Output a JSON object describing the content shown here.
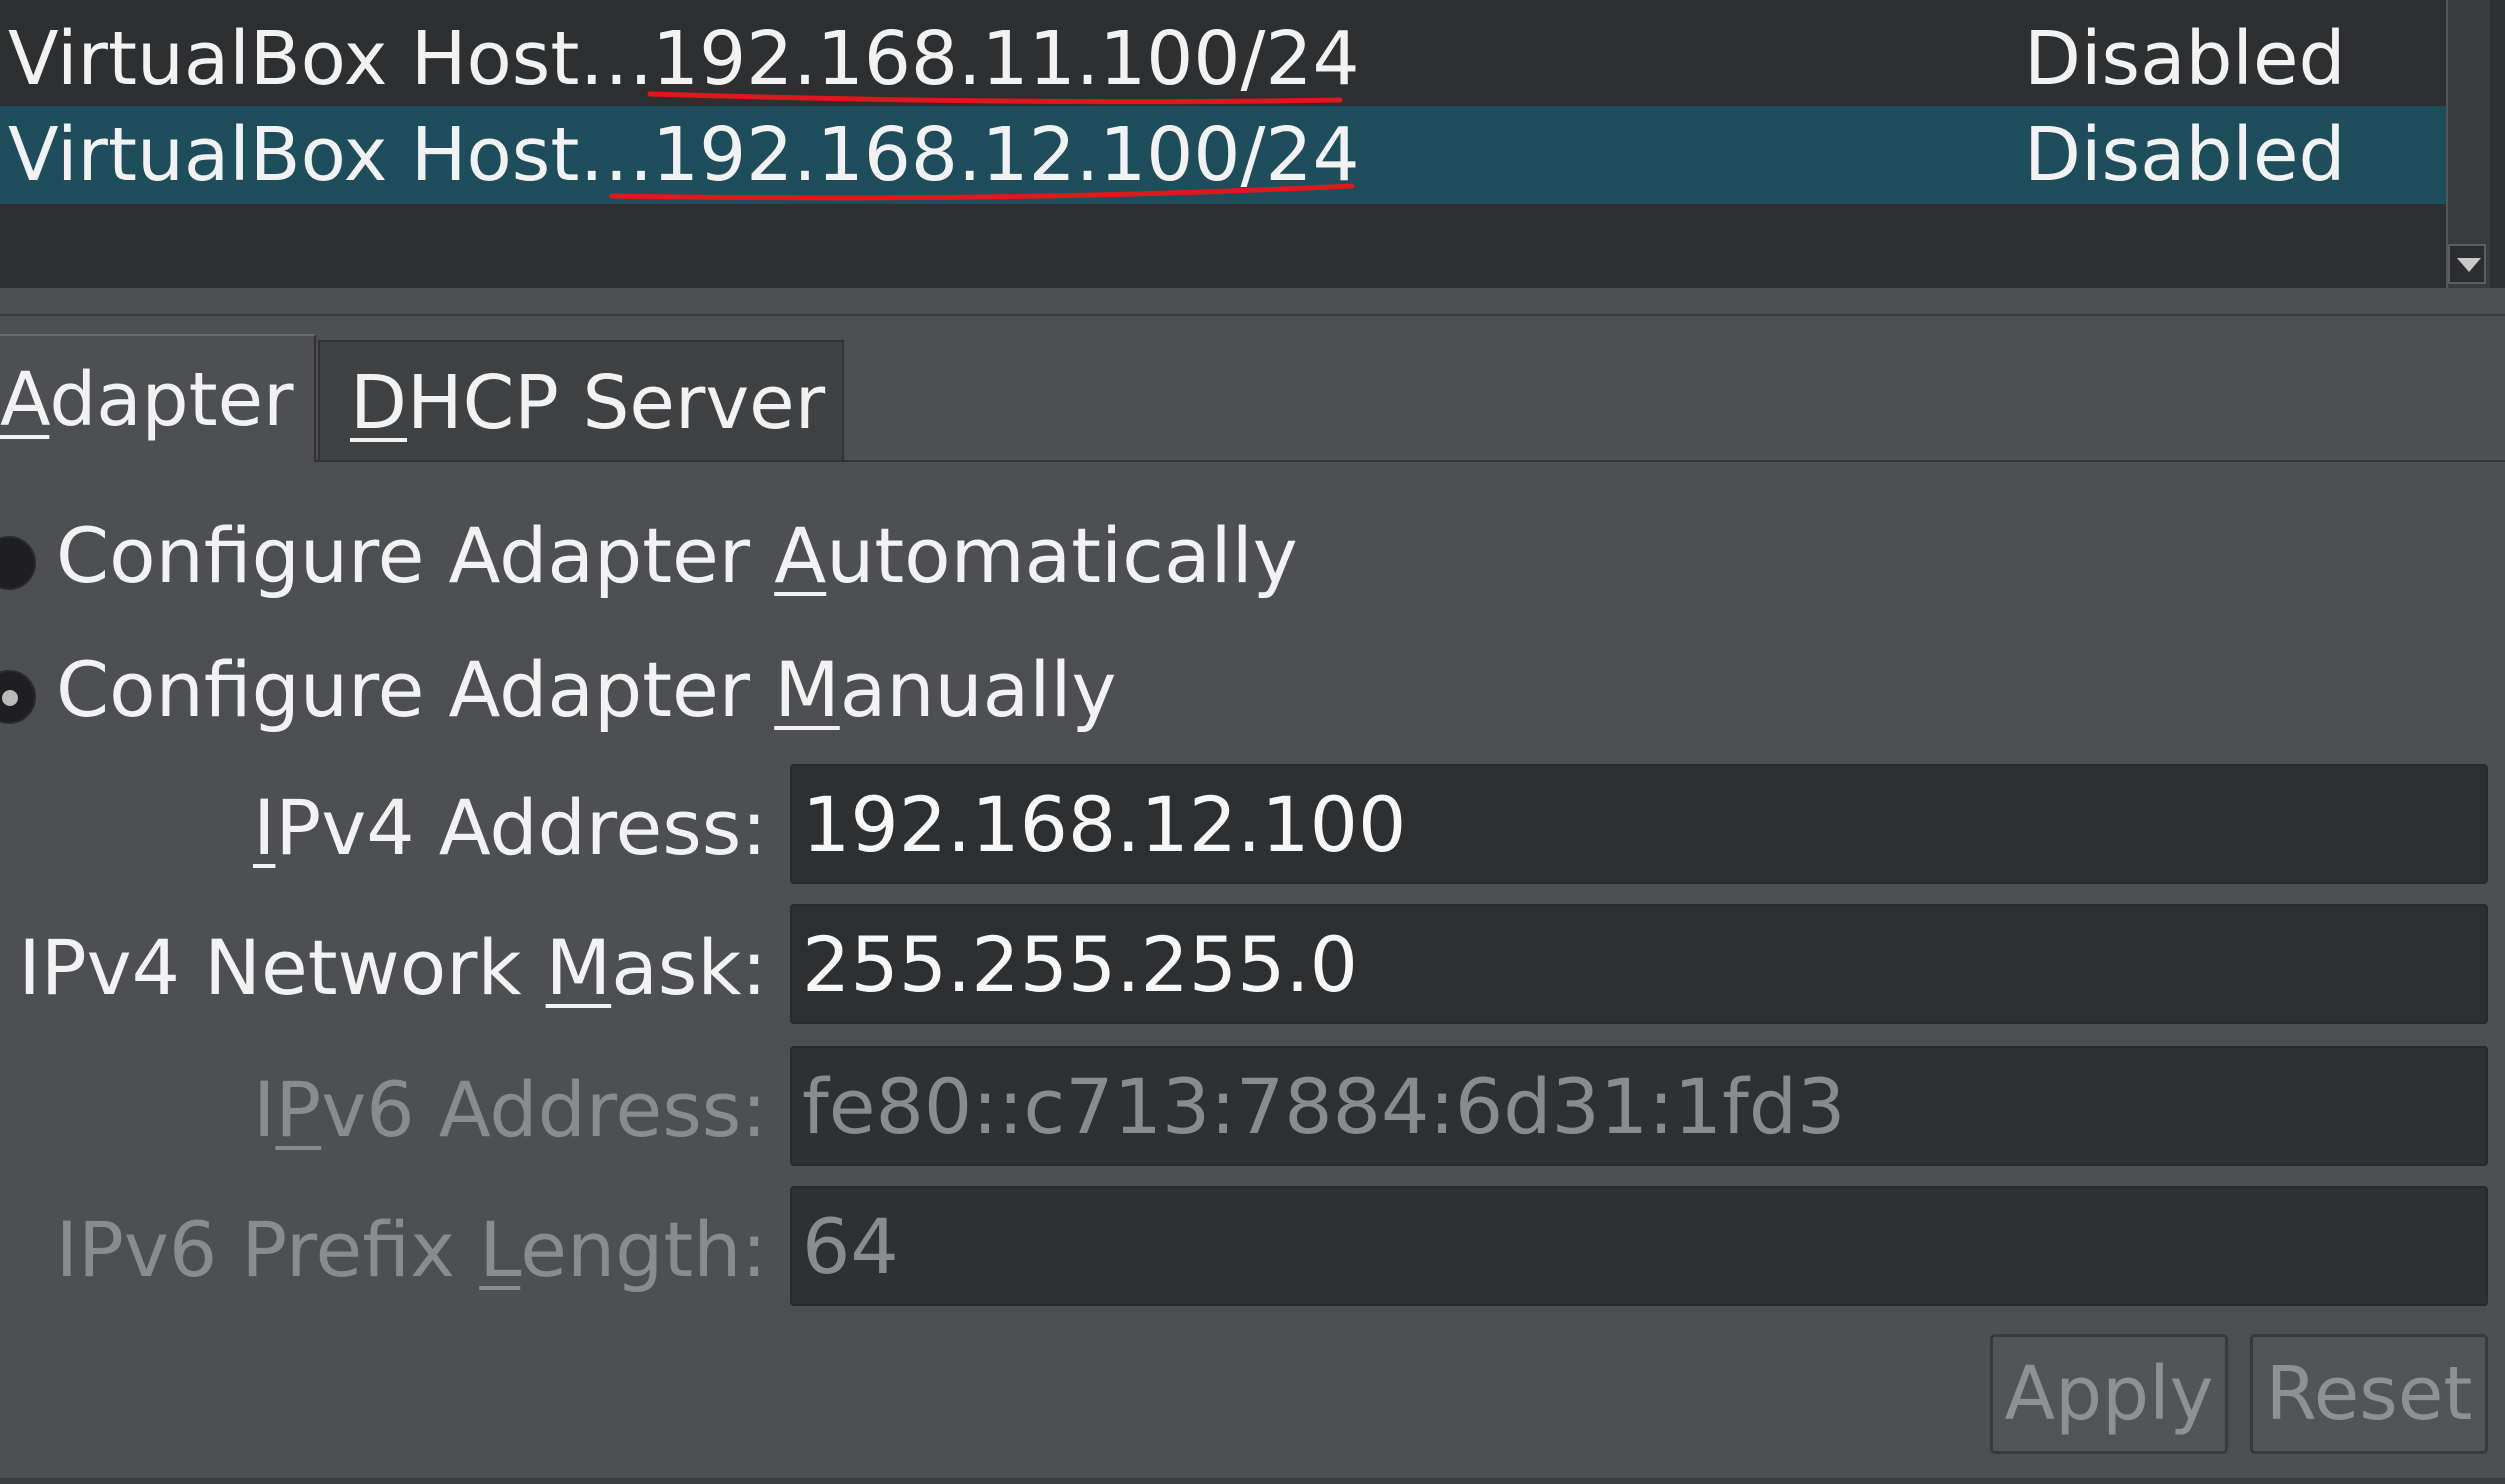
{
  "host_networks": {
    "rows": [
      {
        "name": "VirtualBox Host…",
        "ipv4": "192.168.11.100/24",
        "dhcp": "Disabled",
        "selected": false
      },
      {
        "name": "VirtualBox Host…",
        "ipv4": "192.168.12.100/24",
        "dhcp": "Disabled",
        "selected": true
      }
    ],
    "selection_color": "#1e4e5c",
    "annotation_color": "#e0181e"
  },
  "tabs": [
    {
      "label": "Adapter",
      "mnemonic": "A",
      "rest": "dapter",
      "active": true
    },
    {
      "label": "DHCP Server",
      "mnemonic": "D",
      "rest": "HCP Server",
      "active": false
    }
  ],
  "adapter": {
    "auto": {
      "pre": "Configure Adapter ",
      "mnemonic": "A",
      "post": "utomatically",
      "checked": false
    },
    "manual": {
      "pre": "Configure Adapter ",
      "mnemonic": "M",
      "post": "anually",
      "checked": true
    },
    "fields": {
      "ipv4_address": {
        "pre": "",
        "mnemonic": "I",
        "post": "Pv4 Address:",
        "value": "192.168.12.100",
        "enabled": true
      },
      "ipv4_mask": {
        "pre": "IPv4 Network ",
        "mnemonic": "M",
        "post": "ask:",
        "value": "255.255.255.0",
        "enabled": true
      },
      "ipv6_address": {
        "pre": "I",
        "mnemonic": "P",
        "post": "v6 Address:",
        "value": "fe80::c713:7884:6d31:1fd3",
        "enabled": false
      },
      "ipv6_prefix": {
        "pre": "IPv6 Prefix ",
        "mnemonic": "L",
        "post": "ength:",
        "value": "64",
        "enabled": false
      }
    }
  },
  "buttons": {
    "apply": "Apply",
    "reset": "Reset"
  }
}
